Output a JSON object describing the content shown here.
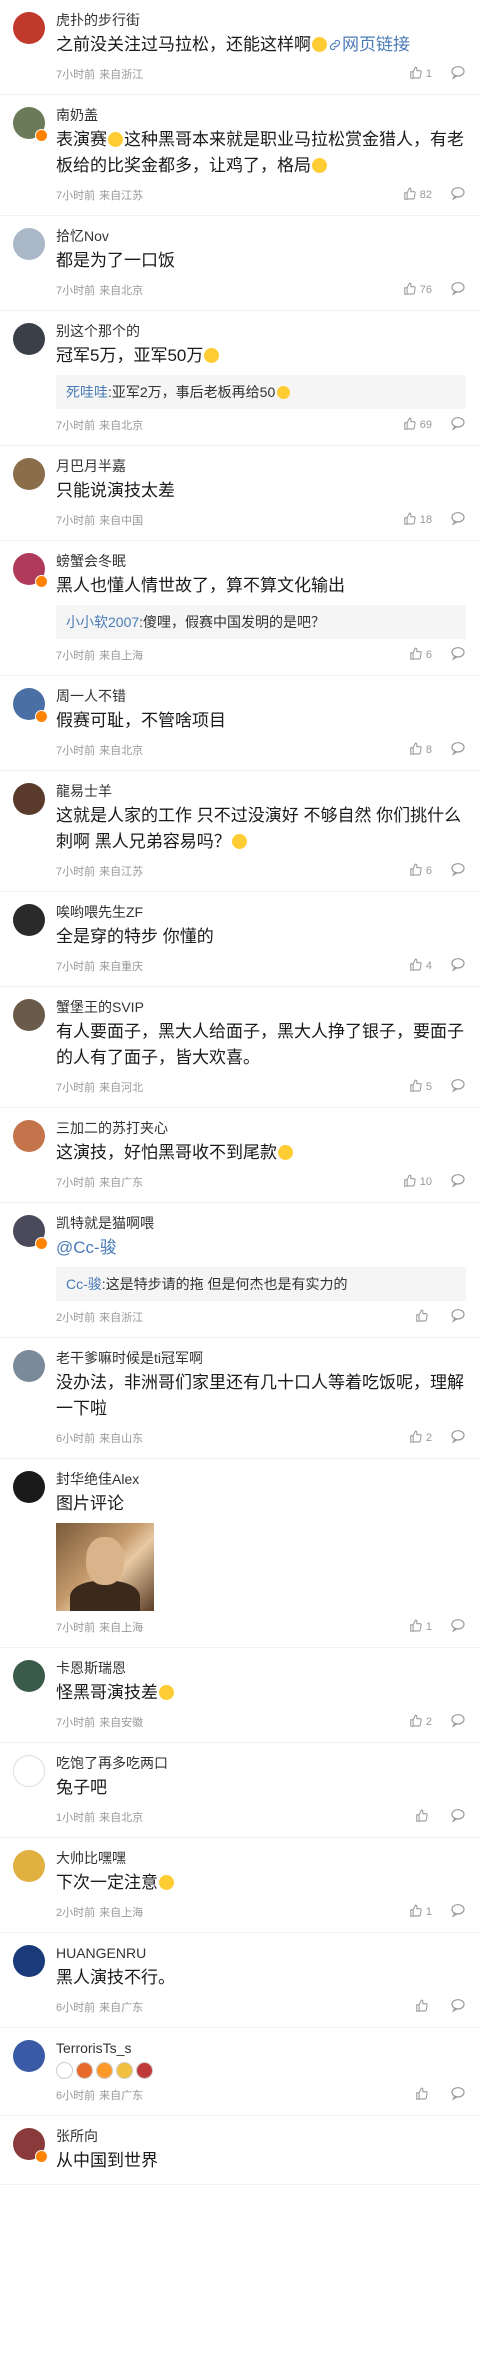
{
  "comments": [
    {
      "name": "虎扑的步行街",
      "text": "之前没关注过马拉松，还能这样啊",
      "link": "网页链接",
      "time": "7小时前",
      "location": "来自浙江",
      "likes": "1",
      "avatar_color": "#c0392b",
      "badge": false
    },
    {
      "name": "南奶盖",
      "text_a": "表演赛",
      "text_b": "这种黑哥本来就是职业马拉松赏金猎人，有老板给的比奖金都多，让鸡了，格局",
      "time": "7小时前",
      "location": "来自江苏",
      "likes": "82",
      "avatar_color": "#6b7b5a",
      "badge": true
    },
    {
      "name": "拾忆Nov",
      "text": "都是为了一口饭",
      "time": "7小时前",
      "location": "来自北京",
      "likes": "76",
      "avatar_color": "#a9b7c6",
      "badge": false
    },
    {
      "name": "别这个那个的",
      "text": "冠军5万，亚军50万",
      "quote_name": "死哇哇",
      "quote_text": ":亚军2万，事后老板再给50",
      "time": "7小时前",
      "location": "来自北京",
      "likes": "69",
      "avatar_color": "#3a3f4a",
      "badge": false
    },
    {
      "name": "月巴月半嘉",
      "text": "只能说演技太差",
      "time": "7小时前",
      "location": "来自中国",
      "likes": "18",
      "avatar_color": "#8a6d4a",
      "badge": false
    },
    {
      "name": "螃蟹会冬眠",
      "text": "黑人也懂人情世故了，算不算文化输出",
      "quote_name": "小小软2007",
      "quote_text": ":傻哩，假赛中国发明的是吧？",
      "time": "7小时前",
      "location": "来自上海",
      "likes": "6",
      "avatar_color": "#b03a5a",
      "badge": true
    },
    {
      "name": "周一人不错",
      "text": "假赛可耻，不管啥项目",
      "time": "7小时前",
      "location": "来自北京",
      "likes": "8",
      "avatar_color": "#4a6fa5",
      "badge": true
    },
    {
      "name": "龍易士羊",
      "text": "这就是人家的工作 只不过没演好 不够自然 你们挑什么刺啊 黑人兄弟容易吗？",
      "time": "7小时前",
      "location": "来自江苏",
      "likes": "6",
      "avatar_color": "#5a3a2a",
      "badge": false
    },
    {
      "name": "唉哟喂先生ZF",
      "text": "全是穿的特步 你懂的",
      "time": "7小时前",
      "location": "来自重庆",
      "likes": "4",
      "avatar_color": "#2a2a2a",
      "badge": false
    },
    {
      "name": "蟹堡王的SVIP",
      "text": "有人要面子，黑大人给面子，黑大人挣了银子，要面子的人有了面子，皆大欢喜。",
      "time": "7小时前",
      "location": "来自河北",
      "likes": "5",
      "avatar_color": "#6a5a4a",
      "badge": false
    },
    {
      "name": "三加二的苏打夹心",
      "text": "这演技，好怕黑哥收不到尾款",
      "time": "7小时前",
      "location": "来自广东",
      "likes": "10",
      "avatar_color": "#c4734a",
      "badge": false
    },
    {
      "name": "凯特就是猫啊喂",
      "mention": "@Cc-骏",
      "quote_name": "Cc-骏",
      "quote_text": ":这是特步请的拖 但是何杰也是有实力的",
      "time": "2小时前",
      "location": "来自浙江",
      "likes": "",
      "avatar_color": "#4a4a5a",
      "badge": true
    },
    {
      "name": "老干爹嘛时候是ti冠军啊",
      "text": "没办法，非洲哥们家里还有几十口人等着吃饭呢，理解一下啦",
      "time": "6小时前",
      "location": "来自山东",
      "likes": "2",
      "avatar_color": "#7a8a9a",
      "badge": false
    },
    {
      "name": "封华绝佳Alex",
      "text": "图片评论",
      "time": "7小时前",
      "location": "来自上海",
      "likes": "1",
      "avatar_color": "#1a1a1a",
      "badge": false
    },
    {
      "name": "卡恩斯瑞恩",
      "text": "怪黑哥演技差",
      "time": "7小时前",
      "location": "来自安徽",
      "likes": "2",
      "avatar_color": "#3a5a4a",
      "badge": false
    },
    {
      "name": "吃饱了再多吃两口",
      "text": "兔子吧",
      "time": "1小时前",
      "location": "来自北京",
      "likes": "",
      "avatar_color": "#ffffff",
      "badge": false
    },
    {
      "name": "大帅比嘿嘿",
      "text": "下次一定注意",
      "time": "2小时前",
      "location": "来自上海",
      "likes": "1",
      "avatar_color": "#e0b040",
      "badge": false
    },
    {
      "name": "HUANGENRU",
      "text": "黑人演技不行。",
      "time": "6小时前",
      "location": "来自广东",
      "likes": "",
      "avatar_color": "#1a3a7a",
      "badge": false
    },
    {
      "name": "TerrorisTs_s",
      "time": "6小时前",
      "location": "来自广东",
      "likes": "",
      "avatar_color": "#3a5aa5",
      "badge": false
    },
    {
      "name": "张所向",
      "text": "从中国到世界",
      "avatar_color": "#8a3a3a",
      "badge": true
    }
  ],
  "colors": {
    "link": "#4a7bb7",
    "meta": "#999999",
    "badge": "#ff8200"
  },
  "icons": {
    "like": "thumbs-up-icon",
    "reply": "comment-bubble-icon",
    "link": "link-icon"
  }
}
